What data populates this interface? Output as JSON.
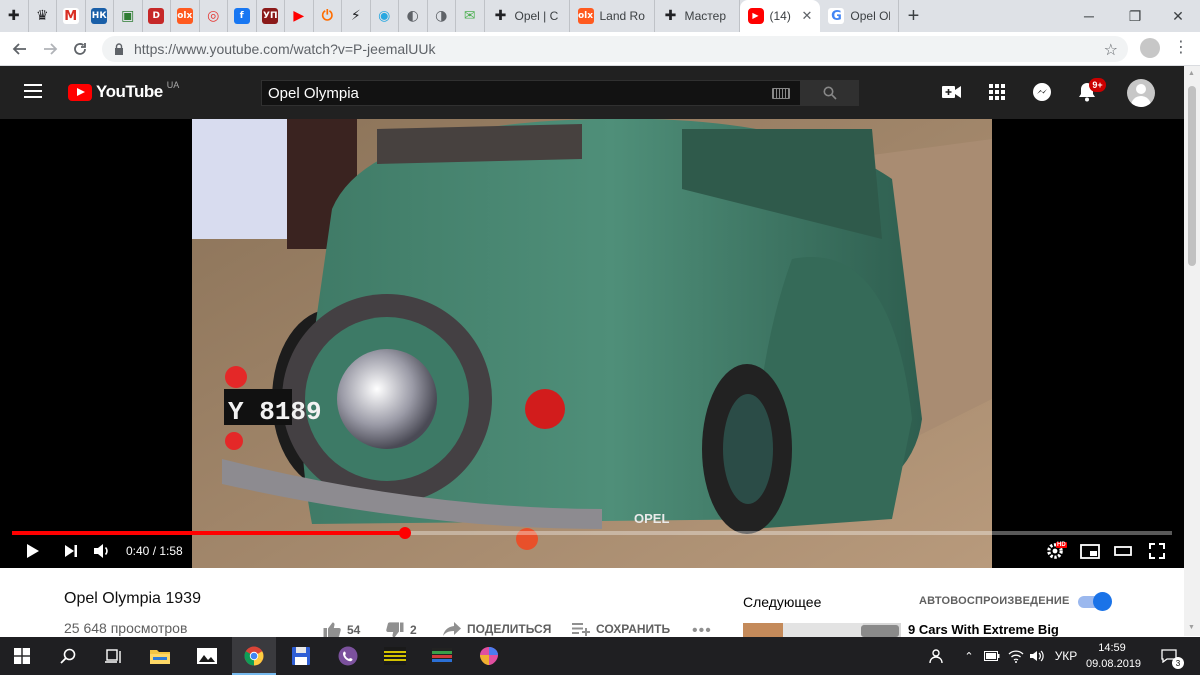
{
  "browser": {
    "tabs": [
      {
        "name": "tab-pinned-1",
        "glyph": "✚",
        "color": "#202124"
      },
      {
        "name": "tab-pinned-2",
        "glyph": "♛",
        "color": "#202124"
      },
      {
        "name": "tab-pinned-3",
        "glyph": "M",
        "color": "#d93025"
      },
      {
        "name": "tab-pinned-4",
        "glyph": "НК",
        "color": "#1a5fa8"
      },
      {
        "name": "tab-pinned-5",
        "glyph": "▣",
        "color": "#2e7d32"
      },
      {
        "name": "tab-pinned-6",
        "glyph": "D",
        "color": "#c62828"
      },
      {
        "name": "tab-pinned-7",
        "glyph": "olx",
        "color": "#ff5a1f"
      },
      {
        "name": "tab-pinned-8",
        "glyph": "◎",
        "color": "#e53935"
      },
      {
        "name": "tab-pinned-9",
        "glyph": "f",
        "color": "#1877f2"
      },
      {
        "name": "tab-pinned-10",
        "glyph": "УП",
        "color": "#8b1a1a"
      },
      {
        "name": "tab-pinned-11",
        "glyph": "▶",
        "color": "#ff0000"
      },
      {
        "name": "tab-pinned-12",
        "glyph": "⏻",
        "color": "#ff6d00"
      },
      {
        "name": "tab-pinned-13",
        "glyph": "⚡",
        "color": "#202124"
      },
      {
        "name": "tab-pinned-14",
        "glyph": "◉",
        "color": "#29a8e0"
      },
      {
        "name": "tab-pinned-15",
        "glyph": "◐",
        "color": "#5f6368"
      },
      {
        "name": "tab-pinned-16",
        "glyph": "◑",
        "color": "#5f6368"
      },
      {
        "name": "tab-pinned-17",
        "glyph": "✉",
        "color": "#4caf50"
      }
    ],
    "titled_tabs": [
      {
        "name": "tab-opel",
        "glyph": "✚",
        "color": "#202124",
        "title": "Opel | C"
      },
      {
        "name": "tab-land-rover",
        "glyph": "olx",
        "color": "#ff5a1f",
        "title": "Land Ro"
      },
      {
        "name": "tab-master",
        "glyph": "✚",
        "color": "#202124",
        "title": "Мастер"
      }
    ],
    "active_tab": {
      "glyph": "▶",
      "color": "#ff0000",
      "title": "(14)"
    },
    "last_tab": {
      "glyph": "G",
      "color": "#4285f4",
      "title": "Opel Ol"
    },
    "url": "https://www.youtube.com/watch?v=P-jeemalUUk"
  },
  "youtube": {
    "logo_text": "YouTube",
    "country_code": "UA",
    "search_value": "Opel Olympia",
    "notification_count": "9+",
    "player": {
      "current_time": "0:40",
      "duration": "1:58",
      "time_display": "0:40 / 1:58",
      "progress_fraction": 0.339,
      "hd_label": "HD"
    },
    "video": {
      "title": "Opel Olympia 1939",
      "views": "25 648 просмотров",
      "likes": "54",
      "dislikes": "2",
      "share_label": "ПОДЕЛИТЬСЯ",
      "save_label": "СОХРАНИТЬ",
      "plate_text": "Y 8189",
      "brand_text": "OPEL"
    },
    "sidebar": {
      "next_label": "Следующее",
      "autoplay_label": "АВТОВОСПРОИЗВЕДЕНИЕ",
      "autoplay_on": true,
      "recommended_title": "9 Cars With Extreme Big"
    }
  },
  "taskbar": {
    "language": "УКР",
    "time": "14:59",
    "date": "09.08.2019",
    "notifications": "3"
  }
}
